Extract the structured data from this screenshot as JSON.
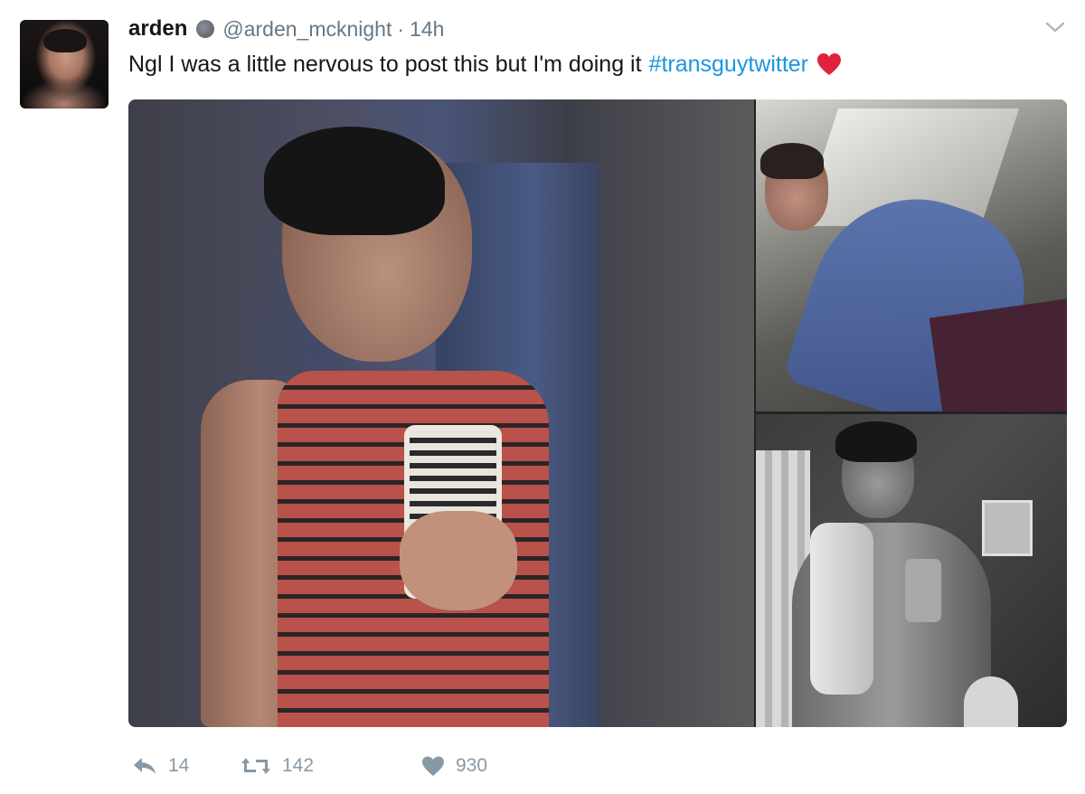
{
  "tweet": {
    "display_name": "arden",
    "handle": "@arden_mcknight",
    "separator": "·",
    "time": "14h",
    "text": "Ngl I was a little nervous to post this but I'm doing it",
    "hashtag": "#transguytwitter"
  },
  "actions": {
    "replies": "14",
    "retweets": "142",
    "likes": "930"
  },
  "icons": {
    "verified_dot": "grey-circle-icon",
    "menu": "chevron-down-icon",
    "emoji": "red-heart-icon",
    "reply": "reply-icon",
    "retweet": "retweet-icon",
    "like": "heart-icon"
  },
  "colors": {
    "text": "#14171a",
    "secondary": "#657786",
    "hashtag": "#1b95e0",
    "action_icon": "#8899a6",
    "heart_emoji": "#e0233b"
  }
}
